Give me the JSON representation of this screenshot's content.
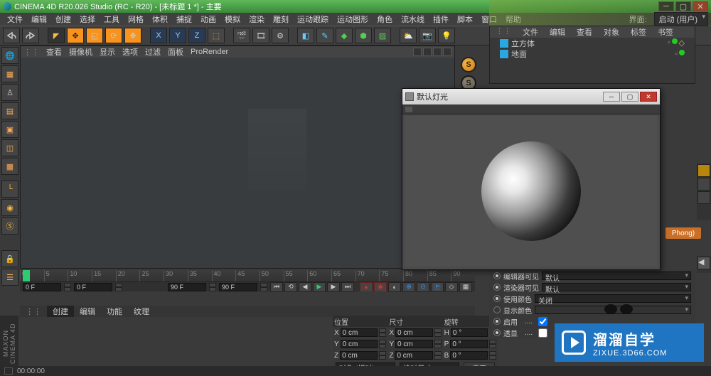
{
  "title": "CINEMA 4D R20.026 Studio (RC - R20) - [未标题 1 *] - 主要",
  "menu": [
    "文件",
    "编辑",
    "创建",
    "选择",
    "工具",
    "网格",
    "体积",
    "捕捉",
    "动画",
    "模拟",
    "渲染",
    "雕刻",
    "运动跟踪",
    "运动图形",
    "角色",
    "流水线",
    "插件",
    "脚本",
    "窗口",
    "帮助"
  ],
  "layout_label": "界面:",
  "layout_value": "启动 (用户)",
  "viewport_menu": [
    "查看",
    "摄像机",
    "显示",
    "选项",
    "过滤",
    "面板",
    "ProRender"
  ],
  "timeline": {
    "start": "0 F",
    "cursor": "0 F",
    "end": "90 F",
    "end2": "90 F",
    "marks": [
      "0",
      "5",
      "10",
      "15",
      "20",
      "25",
      "30",
      "35",
      "40",
      "45",
      "50",
      "55",
      "60",
      "65",
      "70",
      "75",
      "80",
      "85",
      "90"
    ]
  },
  "bottom_tabs": [
    "创建",
    "编辑",
    "功能",
    "纹理"
  ],
  "coord": {
    "headers": [
      "位置",
      "尺寸",
      "旋转"
    ],
    "rows": [
      {
        "l": "X",
        "pv": "0 cm",
        "s": "X",
        "sv": "0 cm",
        "r": "H",
        "rv": "0 °"
      },
      {
        "l": "Y",
        "pv": "0 cm",
        "s": "Y",
        "sv": "0 cm",
        "r": "P",
        "rv": "0 °"
      },
      {
        "l": "Z",
        "pv": "0 cm",
        "s": "Z",
        "sv": "0 cm",
        "r": "B",
        "rv": "0 °"
      }
    ],
    "mode1": "对象 (相对)",
    "mode2": "绝对尺寸",
    "apply": "应用"
  },
  "objects_panel": {
    "tabs": [
      "文件",
      "编辑",
      "查看",
      "对象",
      "标签",
      "书签"
    ],
    "items": [
      {
        "name": "立方体",
        "color": "#2aa6e0"
      },
      {
        "name": "地面",
        "color": "#2aa6e0"
      }
    ]
  },
  "attr": {
    "rows": [
      {
        "label": "编辑器可见",
        "value": "默认"
      },
      {
        "label": "渲染器可见",
        "value": "默认"
      },
      {
        "label": "使用颜色",
        "value": "关闭"
      },
      {
        "label": "显示颜色",
        "value": ""
      }
    ],
    "checks": [
      {
        "label": "启用",
        "on": true
      },
      {
        "label": "透显",
        "on": false
      }
    ]
  },
  "popup_title": "默认灯光",
  "phong": "Phong)",
  "maxon": "MAXON CINEMA 4D",
  "status_time": "00:00:00",
  "watermark": {
    "big": "溜溜自学",
    "small": "ZIXUE.3D66.COM"
  }
}
